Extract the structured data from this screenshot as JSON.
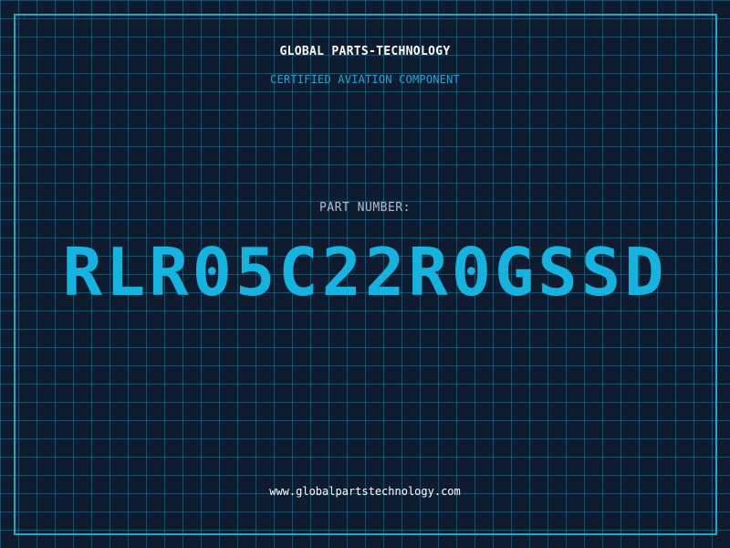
{
  "header": {
    "company": "GLOBAL PARTS-TECHNOLOGY",
    "tagline": "CERTIFIED AVIATION COMPONENT"
  },
  "part": {
    "label": "PART NUMBER:",
    "number": "RLR05C22R0GSSD"
  },
  "footer": {
    "website": "www.globalpartstechnology.com"
  },
  "colors": {
    "background": "#0f1b2e",
    "grid": "#247896",
    "accent": "#15b3e0",
    "border": "#1fa6cc"
  }
}
